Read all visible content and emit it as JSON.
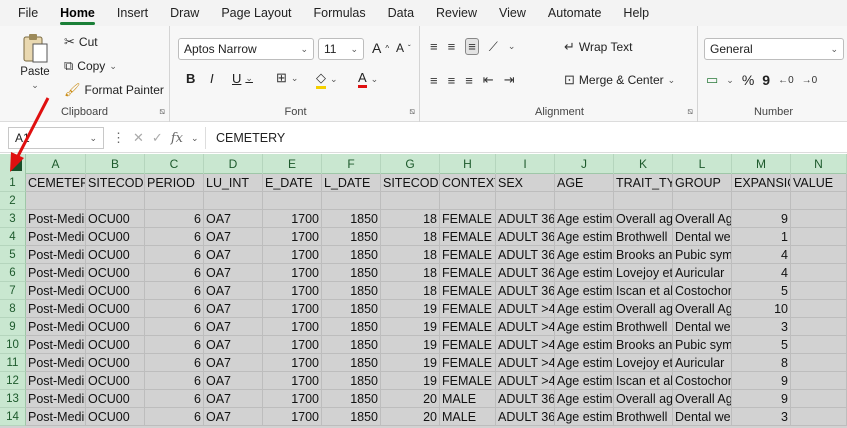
{
  "menu": [
    "File",
    "Home",
    "Insert",
    "Draw",
    "Page Layout",
    "Formulas",
    "Data",
    "Review",
    "View",
    "Automate",
    "Help"
  ],
  "ribbon": {
    "clipboard": {
      "paste": "Paste",
      "cut": "Cut",
      "copy": "Copy",
      "format_painter": "Format Painter",
      "label": "Clipboard"
    },
    "font": {
      "name": "Aptos Narrow",
      "size": "11",
      "bold": "B",
      "italic": "I",
      "underline": "U",
      "grow": "A",
      "shrink": "A",
      "font_color": "A",
      "label": "Font"
    },
    "alignment": {
      "wrap_text": "Wrap Text",
      "merge_center": "Merge & Center",
      "label": "Alignment"
    },
    "number": {
      "format": "General",
      "percent": "%",
      "comma": "9",
      "label": "Number"
    }
  },
  "formula_bar": {
    "name_box": "A1",
    "fx": "fx",
    "content": "CEMETERY"
  },
  "columns": [
    "A",
    "B",
    "C",
    "D",
    "E",
    "F",
    "G",
    "H",
    "I",
    "J",
    "K",
    "L",
    "M",
    "N"
  ],
  "rows": [
    {
      "n": "1",
      "cells": [
        "CEMETERY",
        "SITECODE",
        "PERIOD",
        "LU_INT",
        "E_DATE",
        "L_DATE",
        "SITECODE",
        "CONTEXT",
        "SEX",
        "AGE",
        "TRAIT_TYP",
        "GROUP",
        "EXPANSIO",
        "VALUE"
      ]
    },
    {
      "n": "2",
      "cells": [
        "",
        "",
        "",
        "",
        "",
        "",
        "",
        "",
        "",
        "",
        "",
        "",
        "",
        ""
      ]
    },
    {
      "n": "3",
      "cells": [
        "Post-Medi",
        "OCU00",
        "6",
        "OA7",
        "1700",
        "1850",
        "18",
        "FEMALE",
        "ADULT 36-",
        "Age estim",
        "Overall ag",
        "Overall Ag",
        "9",
        ""
      ]
    },
    {
      "n": "4",
      "cells": [
        "Post-Medi",
        "OCU00",
        "6",
        "OA7",
        "1700",
        "1850",
        "18",
        "FEMALE",
        "ADULT 36-",
        "Age estim",
        "Brothwell",
        "Dental we",
        "1",
        ""
      ]
    },
    {
      "n": "5",
      "cells": [
        "Post-Medi",
        "OCU00",
        "6",
        "OA7",
        "1700",
        "1850",
        "18",
        "FEMALE",
        "ADULT 36-",
        "Age estim",
        "Brooks an",
        "Pubic sym",
        "4",
        ""
      ]
    },
    {
      "n": "6",
      "cells": [
        "Post-Medi",
        "OCU00",
        "6",
        "OA7",
        "1700",
        "1850",
        "18",
        "FEMALE",
        "ADULT 36-",
        "Age estim",
        "Lovejoy et",
        "Auricular",
        "4",
        ""
      ]
    },
    {
      "n": "7",
      "cells": [
        "Post-Medi",
        "OCU00",
        "6",
        "OA7",
        "1700",
        "1850",
        "18",
        "FEMALE",
        "ADULT 36-",
        "Age estim",
        "Iscan et al",
        "Costochor",
        "5",
        ""
      ]
    },
    {
      "n": "8",
      "cells": [
        "Post-Medi",
        "OCU00",
        "6",
        "OA7",
        "1700",
        "1850",
        "19",
        "FEMALE",
        "ADULT >46",
        "Age estim",
        "Overall ag",
        "Overall Ag",
        "10",
        ""
      ]
    },
    {
      "n": "9",
      "cells": [
        "Post-Medi",
        "OCU00",
        "6",
        "OA7",
        "1700",
        "1850",
        "19",
        "FEMALE",
        "ADULT >46",
        "Age estim",
        "Brothwell",
        "Dental we",
        "3",
        ""
      ]
    },
    {
      "n": "10",
      "cells": [
        "Post-Medi",
        "OCU00",
        "6",
        "OA7",
        "1700",
        "1850",
        "19",
        "FEMALE",
        "ADULT >46",
        "Age estim",
        "Brooks an",
        "Pubic sym",
        "5",
        ""
      ]
    },
    {
      "n": "11",
      "cells": [
        "Post-Medi",
        "OCU00",
        "6",
        "OA7",
        "1700",
        "1850",
        "19",
        "FEMALE",
        "ADULT >46",
        "Age estim",
        "Lovejoy et",
        "Auricular",
        "8",
        ""
      ]
    },
    {
      "n": "12",
      "cells": [
        "Post-Medi",
        "OCU00",
        "6",
        "OA7",
        "1700",
        "1850",
        "19",
        "FEMALE",
        "ADULT >46",
        "Age estim",
        "Iscan et al",
        "Costochor",
        "9",
        ""
      ]
    },
    {
      "n": "13",
      "cells": [
        "Post-Medi",
        "OCU00",
        "6",
        "OA7",
        "1700",
        "1850",
        "20",
        "MALE",
        "ADULT 36-",
        "Age estim",
        "Overall ag",
        "Overall Ag",
        "9",
        ""
      ]
    },
    {
      "n": "14",
      "cells": [
        "Post-Medi",
        "OCU00",
        "6",
        "OA7",
        "1700",
        "1850",
        "20",
        "MALE",
        "ADULT 36-",
        "Age estim",
        "Brothwell",
        "Dental we",
        "3",
        ""
      ]
    }
  ],
  "colors": {
    "header_bg": "#c9e7d0",
    "selection_bg": "#d2d2d2",
    "accent": "#1a7f37",
    "annotation": "#e01010"
  }
}
